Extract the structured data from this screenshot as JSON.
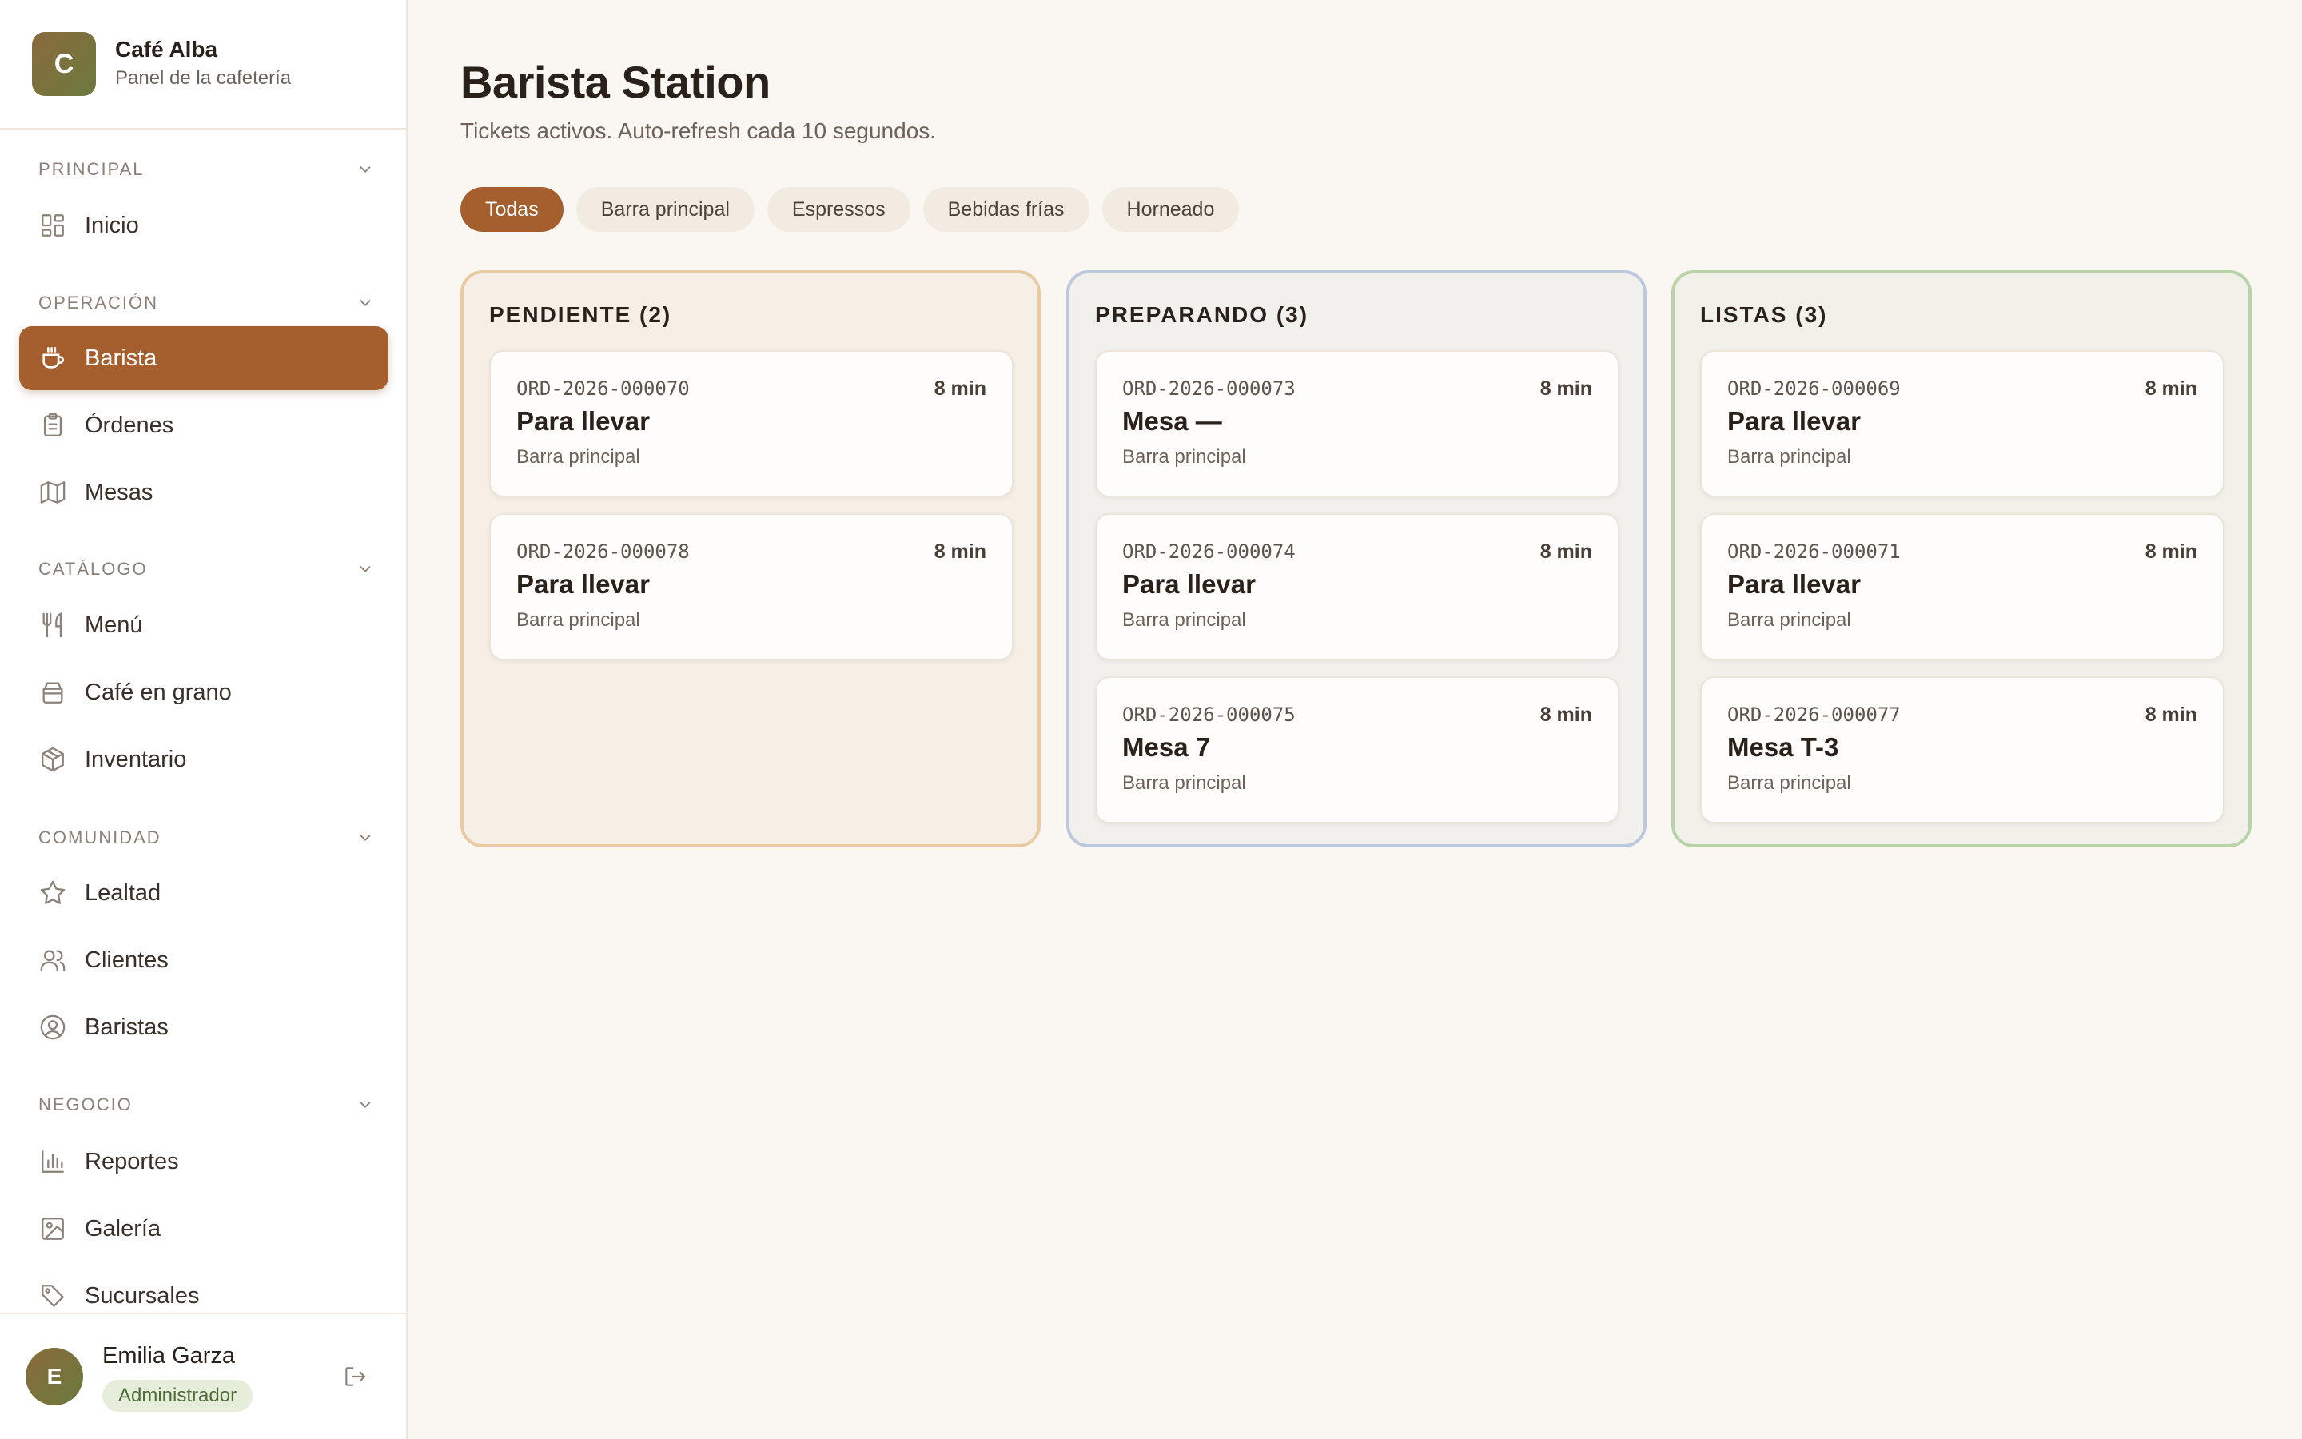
{
  "brand": {
    "initial": "C",
    "name": "Café Alba",
    "subtitle": "Panel de la cafetería"
  },
  "sidebar": {
    "sections": [
      {
        "title": "PRINCIPAL",
        "items": [
          {
            "label": "Inicio",
            "icon": "grid-icon"
          }
        ]
      },
      {
        "title": "OPERACIÓN",
        "items": [
          {
            "label": "Barista",
            "icon": "coffee-cup-icon",
            "active": true
          },
          {
            "label": "Órdenes",
            "icon": "clipboard-icon"
          },
          {
            "label": "Mesas",
            "icon": "map-icon"
          }
        ]
      },
      {
        "title": "CATÁLOGO",
        "items": [
          {
            "label": "Menú",
            "icon": "utensils-icon"
          },
          {
            "label": "Café en grano",
            "icon": "bag-icon"
          },
          {
            "label": "Inventario",
            "icon": "package-icon"
          }
        ]
      },
      {
        "title": "COMUNIDAD",
        "items": [
          {
            "label": "Lealtad",
            "icon": "star-icon"
          },
          {
            "label": "Clientes",
            "icon": "users-icon"
          },
          {
            "label": "Baristas",
            "icon": "user-circle-icon"
          }
        ]
      },
      {
        "title": "NEGOCIO",
        "items": [
          {
            "label": "Reportes",
            "icon": "bar-chart-icon"
          },
          {
            "label": "Galería",
            "icon": "image-icon"
          },
          {
            "label": "Sucursales",
            "icon": "tag-icon"
          }
        ]
      }
    ]
  },
  "user": {
    "initial": "E",
    "name": "Emilia Garza",
    "role": "Administrador"
  },
  "page": {
    "title": "Barista Station",
    "subtitle": "Tickets activos. Auto-refresh cada 10 segundos."
  },
  "filters": [
    {
      "label": "Todas",
      "active": true
    },
    {
      "label": "Barra principal"
    },
    {
      "label": "Espressos"
    },
    {
      "label": "Bebidas frías"
    },
    {
      "label": "Horneado"
    }
  ],
  "columns": [
    {
      "title": "PENDIENTE (2)",
      "tickets": [
        {
          "id": "ORD-2026-000070",
          "time": "8 min",
          "destination": "Para llevar",
          "station": "Barra principal"
        },
        {
          "id": "ORD-2026-000078",
          "time": "8 min",
          "destination": "Para llevar",
          "station": "Barra principal"
        }
      ]
    },
    {
      "title": "PREPARANDO (3)",
      "tickets": [
        {
          "id": "ORD-2026-000073",
          "time": "8 min",
          "destination": "Mesa —",
          "station": "Barra principal"
        },
        {
          "id": "ORD-2026-000074",
          "time": "8 min",
          "destination": "Para llevar",
          "station": "Barra principal"
        },
        {
          "id": "ORD-2026-000075",
          "time": "8 min",
          "destination": "Mesa 7",
          "station": "Barra principal"
        }
      ]
    },
    {
      "title": "LISTAS (3)",
      "tickets": [
        {
          "id": "ORD-2026-000069",
          "time": "8 min",
          "destination": "Para llevar",
          "station": "Barra principal"
        },
        {
          "id": "ORD-2026-000071",
          "time": "8 min",
          "destination": "Para llevar",
          "station": "Barra principal"
        },
        {
          "id": "ORD-2026-000077",
          "time": "8 min",
          "destination": "Mesa T-3",
          "station": "Barra principal"
        }
      ]
    }
  ],
  "colors": {
    "accent": "#a55e2e",
    "pending_border": "#e9cba2",
    "preparing_border": "#bcc8de",
    "ready_border": "#b9d3a8"
  }
}
